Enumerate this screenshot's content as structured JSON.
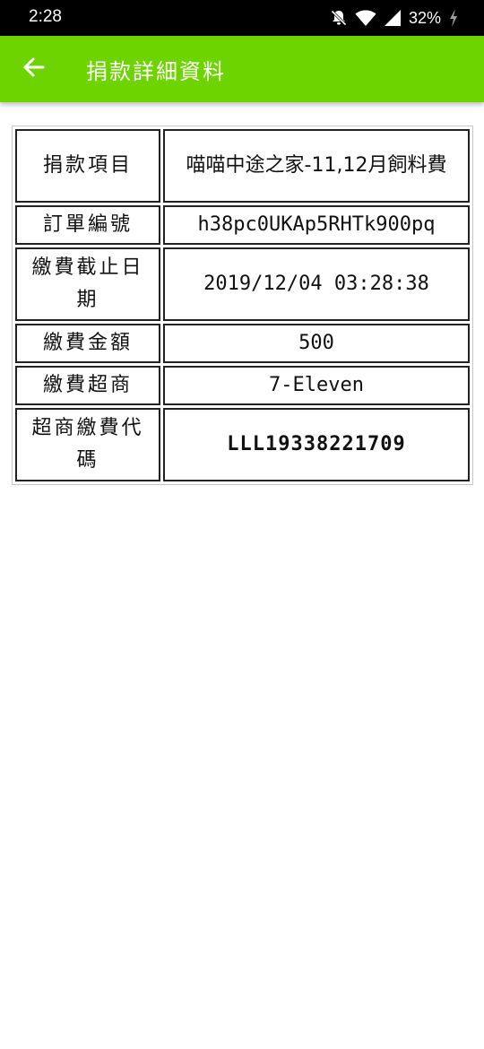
{
  "status_bar": {
    "time": "2:28",
    "battery": "32%",
    "icons": [
      "mute-bell-icon",
      "wifi-icon",
      "cell-signal-icon",
      "battery-charging-icon"
    ]
  },
  "app_bar": {
    "title": "捐款詳細資料",
    "back_icon": "arrow-left-icon",
    "color": "#6dd400"
  },
  "details": {
    "rows": [
      {
        "label": "捐款項目",
        "value": "喵喵中途之家-11,12月飼料費"
      },
      {
        "label": "訂單編號",
        "value": "h38pc0UKAp5RHTk900pq"
      },
      {
        "label": "繳費截止日期",
        "value": "2019/12/04 03:28:38"
      },
      {
        "label": "繳費金額",
        "value": "500"
      },
      {
        "label": "繳費超商",
        "value": "7-Eleven"
      },
      {
        "label": "超商繳費代碼",
        "value": "LLL19338221709"
      }
    ],
    "deadline_color": "#d4141a"
  }
}
